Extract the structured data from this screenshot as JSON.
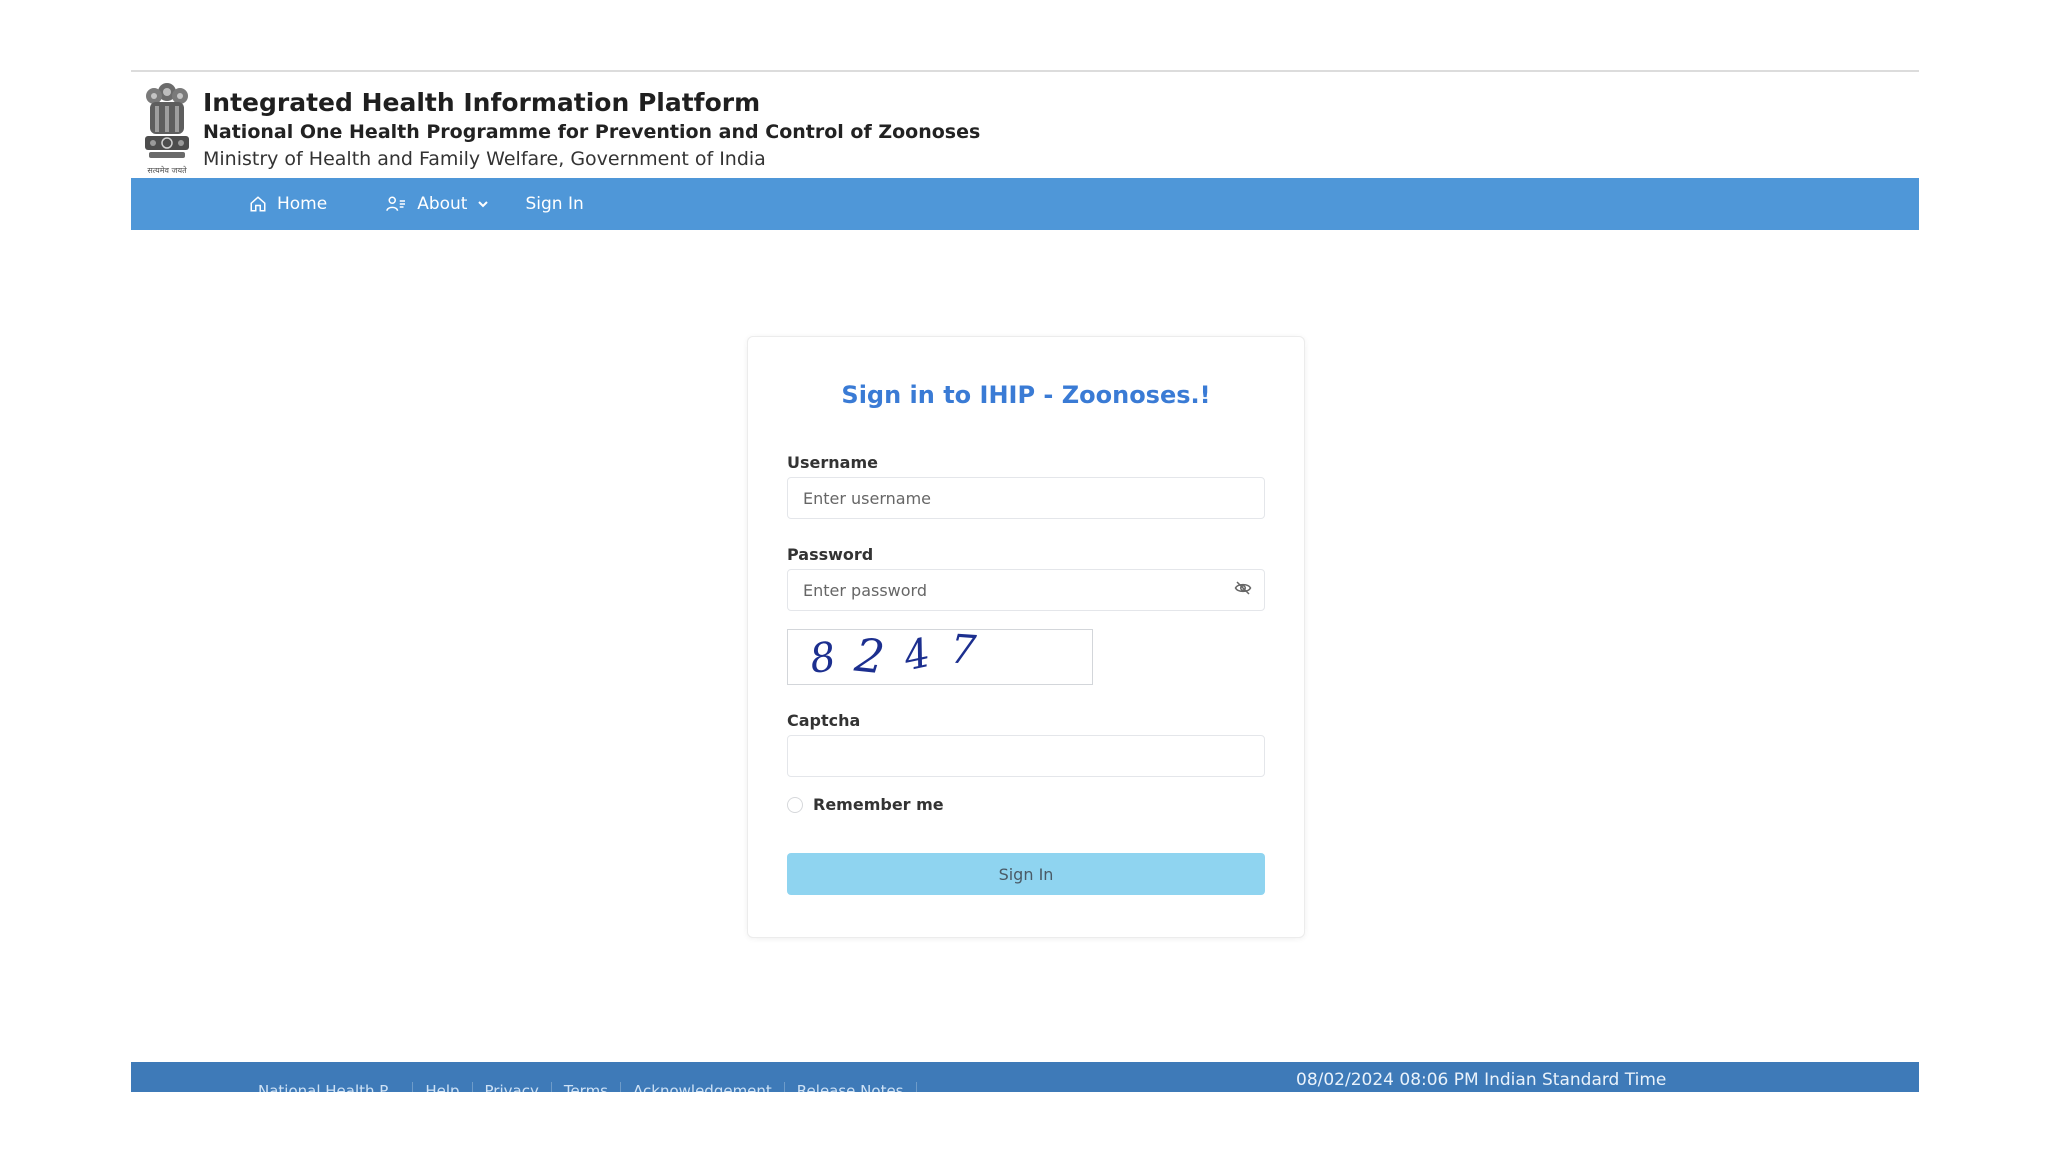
{
  "header": {
    "title": "Integrated Health Information Platform",
    "subtitle": "National One Health Programme for Prevention and Control of Zoonoses",
    "ministry": "Ministry of Health and Family Welfare, Government of India",
    "emblem_caption": "सत्यमेव जयते"
  },
  "nav": {
    "items": [
      {
        "label": "Home",
        "icon": "home-icon"
      },
      {
        "label": "About",
        "icon": "users-icon"
      },
      {
        "label": "Sign In"
      }
    ]
  },
  "login": {
    "title": "Sign in to IHIP - Zoonoses.!",
    "username_label": "Username",
    "username_placeholder": "Enter username",
    "password_label": "Password",
    "password_placeholder": "Enter password",
    "captcha_text": [
      "8",
      "2",
      "4",
      "7"
    ],
    "captcha_label": "Captcha",
    "captcha_value": "",
    "remember_label": "Remember me",
    "submit_label": "Sign In"
  },
  "footer": {
    "links": [
      "National Health P...",
      "Help",
      "Privacy",
      "Terms",
      "Acknowledgement",
      "Release Notes"
    ],
    "timestamp": "08/02/2024 08:06 PM Indian Standard Time"
  },
  "colors": {
    "nav_bg": "#4f97d8",
    "title_blue": "#3a7bd5",
    "button_bg": "#8fd4f0",
    "footer_bg": "#3e7ab8"
  }
}
